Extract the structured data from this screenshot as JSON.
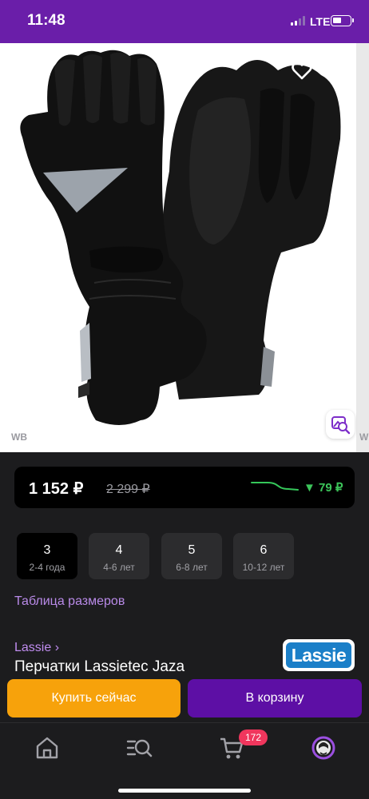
{
  "status_bar": {
    "time": "11:48",
    "network": "LTE"
  },
  "gallery": {
    "watermark": "WB"
  },
  "price": {
    "current": "1 152 ₽",
    "old": "2 299 ₽",
    "drop": "▼ 79 ₽"
  },
  "sizes": [
    {
      "size": "3",
      "age": "2-4 года",
      "selected": true
    },
    {
      "size": "4",
      "age": "4-6 лет",
      "selected": false
    },
    {
      "size": "5",
      "age": "6-8 лет",
      "selected": false
    },
    {
      "size": "6",
      "age": "10-12 лет",
      "selected": false
    }
  ],
  "size_table_link": "Таблица размеров",
  "brand": {
    "link": "Lassie ›",
    "logo_text": "Lassie"
  },
  "product_title": "Перчатки Lassietec Jaza",
  "actions": {
    "buy_now": "Купить сейчас",
    "add_to_cart": "В корзину"
  },
  "tab_bar": {
    "cart_badge": "172"
  },
  "colors": {
    "accent": "#6a1ea9",
    "buy": "#f7a20b",
    "cart": "#5d0fa5",
    "price_drop": "#3cc55a",
    "badge": "#f0365d"
  }
}
